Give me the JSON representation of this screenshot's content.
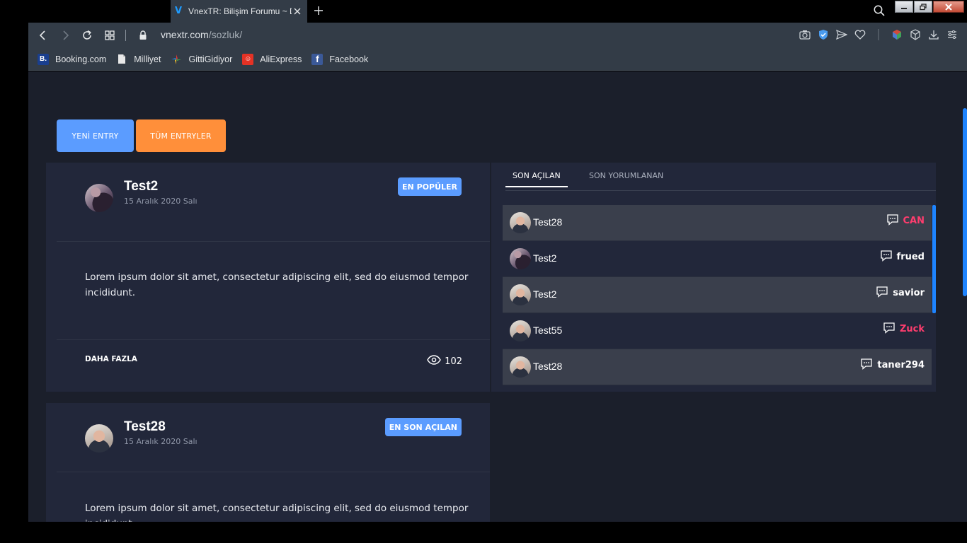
{
  "browser": {
    "tab_title": "VnexTR: Bilişim Forumu ~ D",
    "url_host": "vnextr.com",
    "url_path": "/sozluk/",
    "bookmarks": [
      {
        "label": "Booking.com",
        "icon": "booking-icon",
        "color": "#1a3f8f",
        "glyph": "B."
      },
      {
        "label": "Milliyet",
        "icon": "page-icon",
        "color": "#e8e8e8",
        "glyph": ""
      },
      {
        "label": "GittiGidiyor",
        "icon": "gittigidiyor-icon",
        "color": "#333c47",
        "glyph": ""
      },
      {
        "label": "AliExpress",
        "icon": "aliexpress-icon",
        "color": "#e43225",
        "glyph": "☺"
      },
      {
        "label": "Facebook",
        "icon": "facebook-icon",
        "color": "#3b5998",
        "glyph": "f"
      }
    ]
  },
  "actions": {
    "new_entry": "YENİ ENTRY",
    "all_entries": "TÜM ENTRYLER"
  },
  "entries": [
    {
      "user": "Test2",
      "date": "15 Aralık 2020 Salı",
      "badge": "EN POPÜLER",
      "text": "Lorem ipsum dolor sit amet, consectetur adipiscing elit, sed do eiusmod tempor incididunt.",
      "more": "DAHA FAZLA",
      "views": "102"
    },
    {
      "user": "Test28",
      "date": "15 Aralık 2020 Salı",
      "badge": "EN SON AÇILAN",
      "text": "Lorem ipsum dolor sit amet, consectetur adipiscing elit, sed do eiusmod tempor incididunt."
    }
  ],
  "panel": {
    "tab_active": "SON AÇILAN",
    "tab_inactive": "SON YORUMLANAN",
    "rows": [
      {
        "user": "Test28",
        "commenter": "CAN",
        "commenter_color": "#ff3d6e",
        "avatar": "av-b"
      },
      {
        "user": "Test2",
        "commenter": "frued",
        "commenter_color": "#ffffff",
        "avatar": "av-a"
      },
      {
        "user": "Test2",
        "commenter": "savior",
        "commenter_color": "#ffffff",
        "avatar": "av-b"
      },
      {
        "user": "Test55",
        "commenter": "Zuck",
        "commenter_color": "#ff3d6e",
        "avatar": "av-b"
      },
      {
        "user": "Test28",
        "commenter": "taner294",
        "commenter_color": "#ffffff",
        "avatar": "av-b"
      }
    ]
  },
  "colors": {
    "accent_blue": "#5b9cff",
    "accent_orange": "#ff8f3a",
    "highlight_red": "#ff3d6e"
  }
}
